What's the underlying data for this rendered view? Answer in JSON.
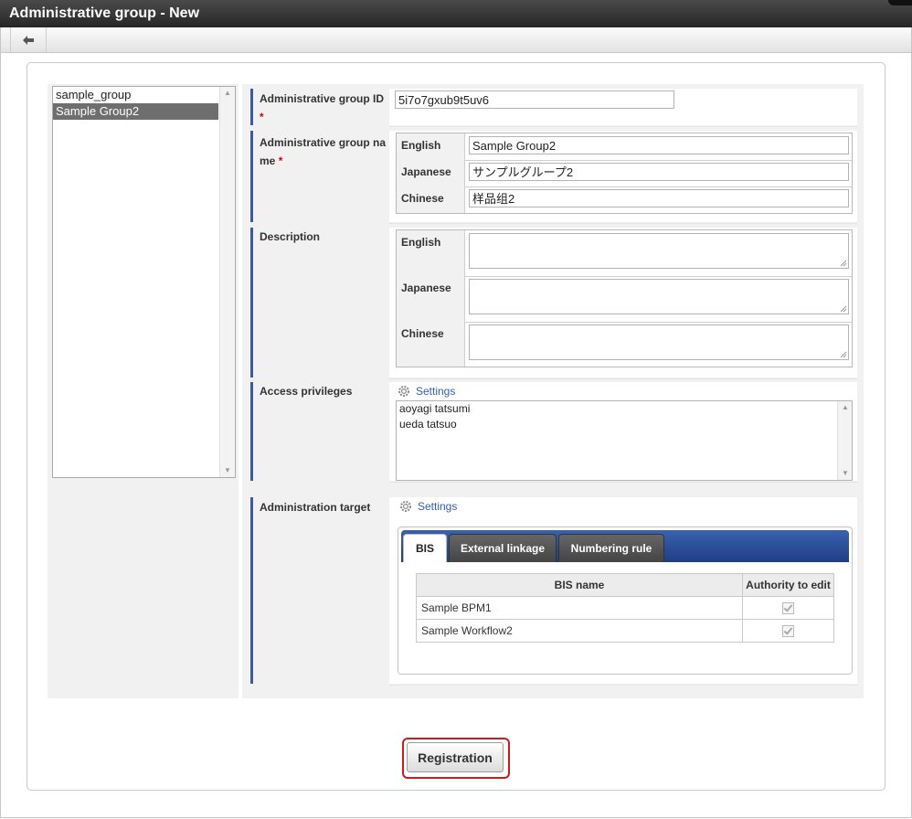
{
  "window": {
    "title": "Administrative group - New"
  },
  "toolbar": {
    "back_icon": "arrow-left-icon"
  },
  "group_list": {
    "items": [
      "sample_group",
      "Sample Group2"
    ],
    "selected": "Sample Group2"
  },
  "form": {
    "group_id": {
      "label": "Administrative group ID",
      "required_mark": "*",
      "value": "5i7o7gxub9t5uv6"
    },
    "group_name": {
      "label": "Administrative group na me",
      "required_mark": "*",
      "rows": [
        {
          "lang": "English",
          "value": "Sample Group2"
        },
        {
          "lang": "Japanese",
          "value": "サンプルグループ2"
        },
        {
          "lang": "Chinese",
          "value": "样品组2"
        }
      ]
    },
    "description": {
      "label": "Description",
      "rows": [
        {
          "lang": "English",
          "value": ""
        },
        {
          "lang": "Japanese",
          "value": ""
        },
        {
          "lang": "Chinese",
          "value": ""
        }
      ]
    },
    "access_privileges": {
      "label": "Access privileges",
      "settings_label": "Settings",
      "members": [
        "aoyagi tatsumi",
        "ueda tatsuo"
      ]
    },
    "administration_target": {
      "label": "Administration target",
      "settings_label": "Settings",
      "tabs": [
        "BIS",
        "External linkage",
        "Numbering rule"
      ],
      "active_tab": "BIS",
      "table": {
        "headers": [
          "BIS name",
          "Authority to edit"
        ],
        "rows": [
          {
            "name": "Sample BPM1",
            "authority": true
          },
          {
            "name": "Sample Workflow2",
            "authority": true
          }
        ]
      }
    }
  },
  "actions": {
    "register_label": "Registration"
  },
  "colors": {
    "accent_bar": "#3b5aa0",
    "tab_bar": "#1d3f85",
    "highlight_outline": "#c81d1d",
    "link": "#2f5fb3"
  }
}
